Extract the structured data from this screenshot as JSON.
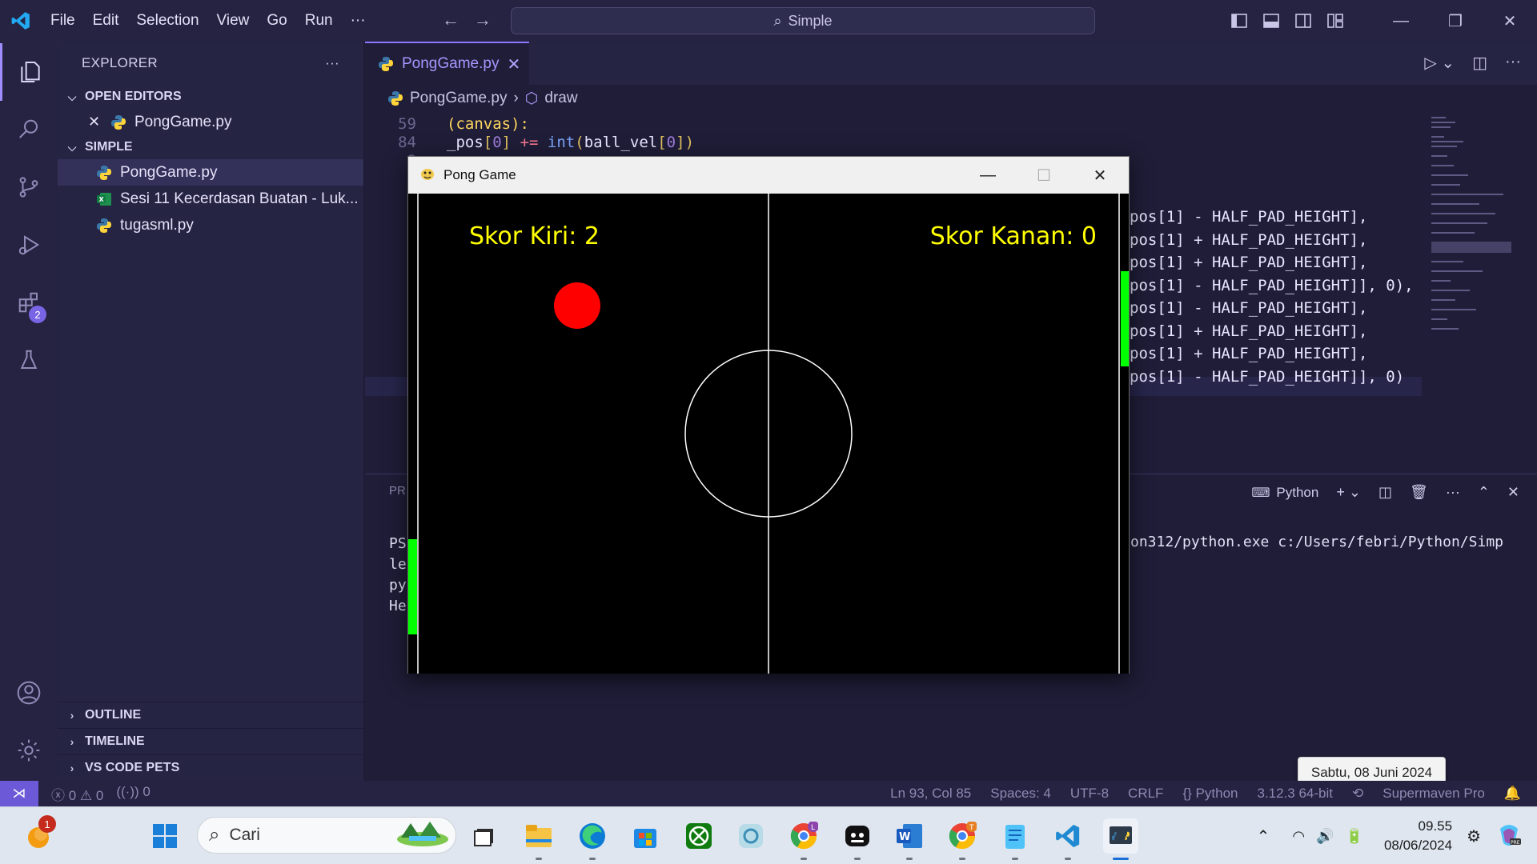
{
  "menu": [
    "File",
    "Edit",
    "Selection",
    "View",
    "Go",
    "Run",
    "···"
  ],
  "command_center": "Simple",
  "sidebar": {
    "title": "EXPLORER",
    "open_editors_label": "OPEN EDITORS",
    "open_editors": [
      {
        "name": "PongGame.py"
      }
    ],
    "folder_label": "SIMPLE",
    "files": [
      {
        "name": "PongGame.py",
        "type": "python"
      },
      {
        "name": "Sesi 11 Kecerdasan Buatan - Luk...",
        "type": "excel"
      },
      {
        "name": "tugasml.py",
        "type": "python"
      }
    ],
    "bottom_sections": [
      "OUTLINE",
      "TIMELINE",
      "VS CODE PETS"
    ]
  },
  "activity": {
    "extensions_badge": "2"
  },
  "editor": {
    "tab": "PongGame.py",
    "breadcrumb": {
      "file": "PongGame.py",
      "symbol": "draw"
    },
    "line_numbers": [
      "59",
      "84",
      "8",
      "8",
      "8",
      "8",
      "9",
      "9",
      "9",
      "9",
      "9",
      "9",
      "9",
      "9",
      "9"
    ],
    "right_lines": [
      "pos[1] - HALF_PAD_HEIGHT],",
      "pos[1] + HALF_PAD_HEIGHT],",
      "pos[1] + HALF_PAD_HEIGHT],",
      "pos[1] - HALF_PAD_HEIGHT]], 0),",
      "pos[1] - HALF_PAD_HEIGHT],",
      "pos[1] + HALF_PAD_HEIGHT],",
      "pos[1] + HALF_PAD_HEIGHT],",
      "pos[1] - HALF_PAD_HEIGHT]], 0)"
    ]
  },
  "panel": {
    "tab_prefix": "PR",
    "terminal_kind": "Python",
    "term_left": [
      "PS",
      "le",
      "py",
      "He"
    ],
    "term_right": "on312/python.exe c:/Users/febri/Python/Simp"
  },
  "statusbar": {
    "errors": "0",
    "warnings": "0",
    "ports": "0",
    "position": "Ln 93, Col 85",
    "spaces": "Spaces: 4",
    "encoding": "UTF-8",
    "eol": "CRLF",
    "language": "Python",
    "interpreter": "3.12.3 64-bit",
    "extension": "Supermaven Pro"
  },
  "tooltip": "Sabtu, 08 Juni 2024",
  "pong": {
    "title": "Pong Game",
    "score_left": "Skor Kiri: 2",
    "score_right": "Skor Kanan: 0",
    "colors": {
      "ball": "#ff0000",
      "paddle": "#00ff00",
      "score": "#ffff00",
      "line": "#ffffff"
    }
  },
  "taskbar": {
    "search_placeholder": "Cari",
    "notification_badge": "1",
    "time": "09.55",
    "date": "08/06/2024"
  }
}
